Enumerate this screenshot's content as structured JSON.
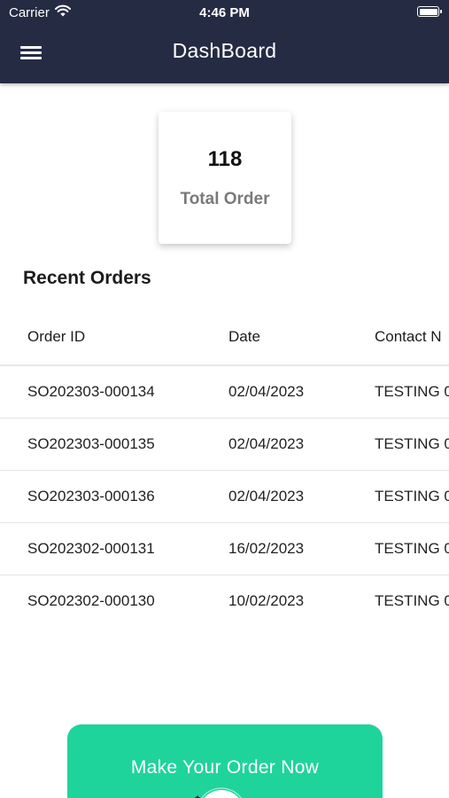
{
  "status_bar": {
    "carrier": "Carrier",
    "time": "4:46 PM"
  },
  "header": {
    "title": "DashBoard",
    "background_color": "#262b44"
  },
  "summary": {
    "total_value": "118",
    "total_label": "Total Order"
  },
  "recent_orders": {
    "title": "Recent Orders",
    "columns": [
      "Order ID",
      "Date",
      "Contact N"
    ],
    "rows": [
      [
        "SO202303-000134",
        "02/04/2023",
        "TESTING 0"
      ],
      [
        "SO202303-000135",
        "02/04/2023",
        "TESTING 0"
      ],
      [
        "SO202303-000136",
        "02/04/2023",
        "TESTING 0"
      ],
      [
        "SO202302-000131",
        "16/02/2023",
        "TESTING 0"
      ],
      [
        "SO202302-000130",
        "10/02/2023",
        "TESTING 0"
      ]
    ]
  },
  "cta": {
    "label": "Make Your Order Now",
    "color": "#1fd49a",
    "icon": "order-illustration-icon"
  }
}
